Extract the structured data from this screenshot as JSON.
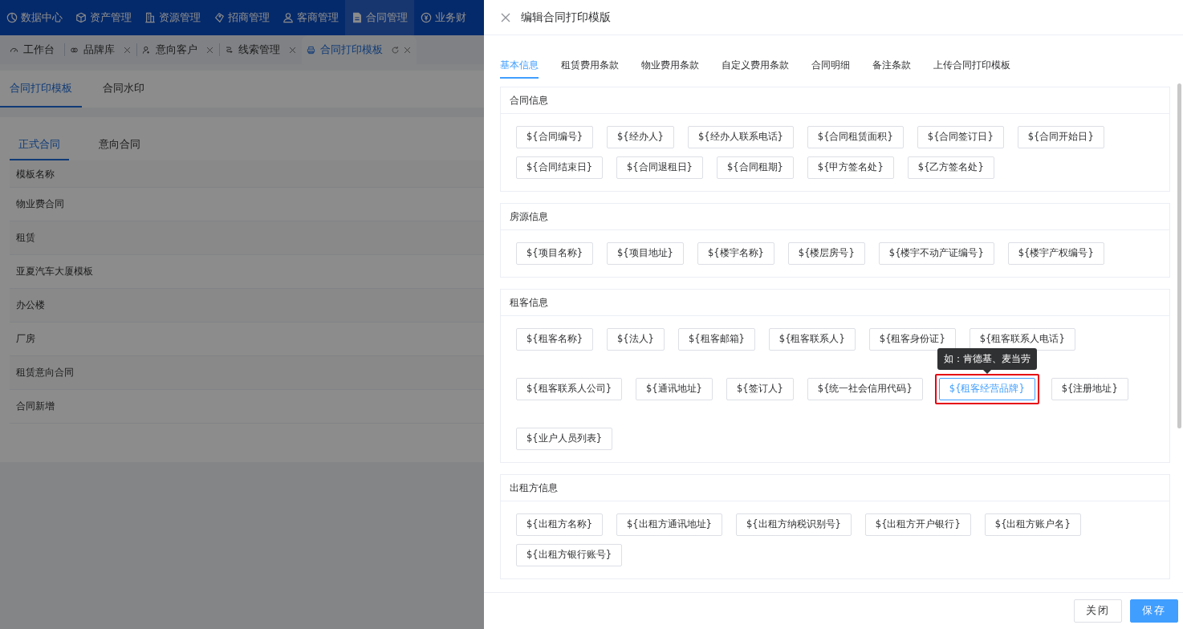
{
  "nav": {
    "items": [
      {
        "label": "数据中心",
        "selected": false
      },
      {
        "label": "资产管理",
        "selected": false
      },
      {
        "label": "资源管理",
        "selected": false
      },
      {
        "label": "招商管理",
        "selected": false
      },
      {
        "label": "客商管理",
        "selected": false
      },
      {
        "label": "合同管理",
        "selected": true
      },
      {
        "label": "业务财",
        "selected": false
      }
    ]
  },
  "page_tabs": [
    {
      "label": "工作台",
      "closable": false,
      "selected": false
    },
    {
      "label": "品牌库",
      "closable": true,
      "selected": false
    },
    {
      "label": "意向客户",
      "closable": true,
      "selected": false
    },
    {
      "label": "线索管理",
      "closable": true,
      "selected": false
    },
    {
      "label": "合同打印模板",
      "closable": true,
      "selected": true
    }
  ],
  "sub_tabs": [
    {
      "label": "合同打印模板",
      "selected": true
    },
    {
      "label": "合同水印",
      "selected": false
    }
  ],
  "contract_tabs": [
    {
      "label": "正式合同",
      "selected": true
    },
    {
      "label": "意向合同",
      "selected": false
    }
  ],
  "table": {
    "columns": [
      "模板名称"
    ],
    "rows": [
      [
        "物业费合同"
      ],
      [
        "租赁"
      ],
      [
        "亚夏汽车大厦模板"
      ],
      [
        "办公楼"
      ],
      [
        "厂房"
      ],
      [
        "租赁意向合同"
      ],
      [
        "合同新增"
      ]
    ]
  },
  "drawer": {
    "title": "编辑合同打印模版",
    "tabs": [
      {
        "label": "基本信息",
        "selected": true
      },
      {
        "label": "租赁费用条款",
        "selected": false
      },
      {
        "label": "物业费用条款",
        "selected": false
      },
      {
        "label": "自定义费用条款",
        "selected": false
      },
      {
        "label": "合同明细",
        "selected": false
      },
      {
        "label": "备注条款",
        "selected": false
      },
      {
        "label": "上传合同打印模板",
        "selected": false
      }
    ],
    "sections": [
      {
        "title": "合同信息",
        "fields": [
          {
            "label": "${合同编号}",
            "highlighted": false
          },
          {
            "label": "${经办人}",
            "highlighted": false
          },
          {
            "label": "${经办人联系电话}",
            "highlighted": false
          },
          {
            "label": "${合同租赁面积}",
            "highlighted": false
          },
          {
            "label": "${合同签订日}",
            "highlighted": false
          },
          {
            "label": "${合同开始日}",
            "highlighted": false
          },
          {
            "label": "${合同结束日}",
            "highlighted": false
          },
          {
            "label": "${合同退租日}",
            "highlighted": false
          },
          {
            "label": "${合同租期}",
            "highlighted": false
          },
          {
            "label": "${甲方签名处}",
            "highlighted": false
          },
          {
            "label": "${乙方签名处}",
            "highlighted": false
          }
        ]
      },
      {
        "title": "房源信息",
        "fields": [
          {
            "label": "${项目名称}",
            "highlighted": false
          },
          {
            "label": "${项目地址}",
            "highlighted": false
          },
          {
            "label": "${楼宇名称}",
            "highlighted": false
          },
          {
            "label": "${楼层房号}",
            "highlighted": false
          },
          {
            "label": "${楼宇不动产证编号}",
            "highlighted": false
          },
          {
            "label": "${楼宇产权编号}",
            "highlighted": false
          }
        ]
      },
      {
        "title": "租客信息",
        "fields": [
          {
            "label": "${租客名称}",
            "highlighted": false
          },
          {
            "label": "${法人}",
            "highlighted": false
          },
          {
            "label": "${租客邮箱}",
            "highlighted": false
          },
          {
            "label": "${租客联系人}",
            "highlighted": false
          },
          {
            "label": "${租客身份证}",
            "highlighted": false
          },
          {
            "label": "${租客联系人电话}",
            "highlighted": false
          },
          {
            "label": "${租客联系人公司}",
            "highlighted": false
          },
          {
            "label": "${通讯地址}",
            "highlighted": false
          },
          {
            "label": "${签订人}",
            "highlighted": false
          },
          {
            "label": "${统一社会信用代码}",
            "highlighted": false
          },
          {
            "label": "${租客经营品牌}",
            "highlighted": true,
            "tooltip": "如：肯德基、麦当劳"
          },
          {
            "label": "${注册地址}",
            "highlighted": false
          },
          {
            "label": "${业户人员列表}",
            "highlighted": false
          }
        ]
      },
      {
        "title": "出租方信息",
        "fields": [
          {
            "label": "${出租方名称}",
            "highlighted": false
          },
          {
            "label": "${出租方通讯地址}",
            "highlighted": false
          },
          {
            "label": "${出租方纳税识别号}",
            "highlighted": false
          },
          {
            "label": "${出租方开户银行}",
            "highlighted": false
          },
          {
            "label": "${出租方账户名}",
            "highlighted": false
          },
          {
            "label": "${出租方银行账号}",
            "highlighted": false
          }
        ]
      }
    ],
    "buttons": [
      {
        "label": "关闭",
        "kind": "default"
      },
      {
        "label": "保存",
        "kind": "primary"
      }
    ]
  }
}
